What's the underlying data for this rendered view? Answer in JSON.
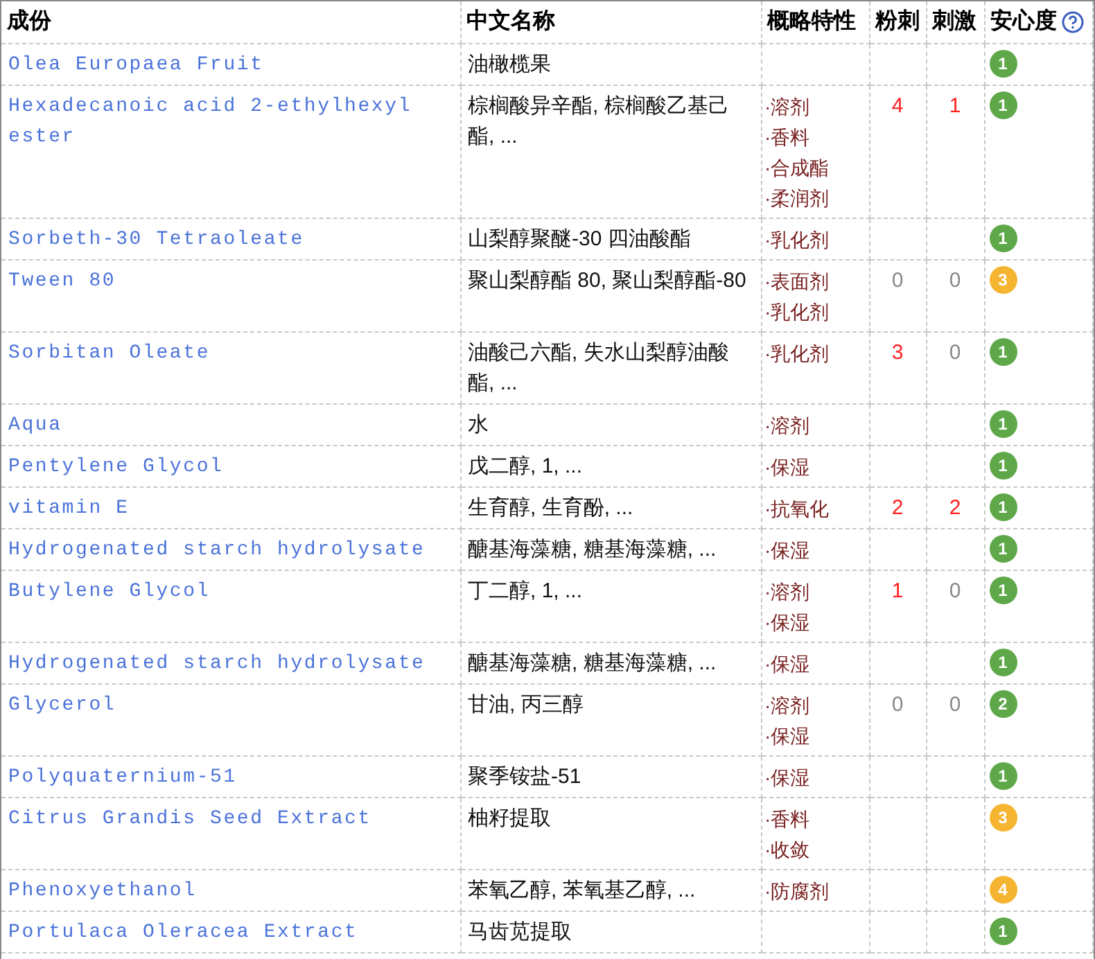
{
  "table": {
    "columns": [
      "成份",
      "中文名称",
      "概略特性",
      "粉刺",
      "刺激",
      "安心度"
    ],
    "rows": [
      {
        "name": "Olea Europaea Fruit",
        "chinese": "油橄榄果",
        "traits": [],
        "safety": {
          "value": "1",
          "color": "#5fa84a"
        }
      },
      {
        "name": "Hexadecanoic acid 2-ethylhexyl ester",
        "chinese": "棕榈酸异辛酯, 棕榈酸乙基己酯, ...",
        "traits": [
          "·溶剂",
          "·香料",
          "·合成酯",
          "·柔润剂"
        ],
        "acne": {
          "value": "4",
          "color": "#ff2020"
        },
        "irritation": {
          "value": "1",
          "color": "#ff2020"
        },
        "safety": {
          "value": "1",
          "color": "#5fa84a"
        }
      },
      {
        "name": "Sorbeth-30 Tetraoleate",
        "chinese": "山梨醇聚醚-30 四油酸酯",
        "traits": [
          "·乳化剂"
        ],
        "safety": {
          "value": "1",
          "color": "#5fa84a"
        }
      },
      {
        "name": "Tween 80",
        "chinese": "聚山梨醇酯 80, 聚山梨醇酯-80",
        "traits": [
          "·表面剂",
          "·乳化剂"
        ],
        "acne": {
          "value": "0",
          "color": "#888888"
        },
        "irritation": {
          "value": "0",
          "color": "#888888"
        },
        "safety": {
          "value": "3",
          "color": "#f5b531"
        }
      },
      {
        "name": "Sorbitan Oleate",
        "chinese": "油酸己六酯, 失水山梨醇油酸酯, ...",
        "traits": [
          "·乳化剂"
        ],
        "acne": {
          "value": "3",
          "color": "#ff2020"
        },
        "irritation": {
          "value": "0",
          "color": "#888888"
        },
        "safety": {
          "value": "1",
          "color": "#5fa84a"
        }
      },
      {
        "name": "Aqua",
        "chinese": "水",
        "traits": [
          "·溶剂"
        ],
        "safety": {
          "value": "1",
          "color": "#5fa84a"
        }
      },
      {
        "name": "Pentylene Glycol",
        "chinese": "戊二醇, 1, ...",
        "traits": [
          "·保湿"
        ],
        "safety": {
          "value": "1",
          "color": "#5fa84a"
        }
      },
      {
        "name": "vitamin E",
        "chinese": "生育醇, 生育酚, ...",
        "traits": [
          "·抗氧化"
        ],
        "acne": {
          "value": "2",
          "color": "#ff2020"
        },
        "irritation": {
          "value": "2",
          "color": "#ff2020"
        },
        "safety": {
          "value": "1",
          "color": "#5fa84a"
        }
      },
      {
        "name": "Hydrogenated starch hydrolysate",
        "chinese": "醣基海藻糖, 糖基海藻糖, ...",
        "traits": [
          "·保湿"
        ],
        "safety": {
          "value": "1",
          "color": "#5fa84a"
        }
      },
      {
        "name": "Butylene Glycol",
        "chinese": "丁二醇, 1, ...",
        "traits": [
          "·溶剂",
          "·保湿"
        ],
        "acne": {
          "value": "1",
          "color": "#ff2020"
        },
        "irritation": {
          "value": "0",
          "color": "#888888"
        },
        "safety": {
          "value": "1",
          "color": "#5fa84a"
        }
      },
      {
        "name": "Hydrogenated starch hydrolysate",
        "chinese": "醣基海藻糖, 糖基海藻糖, ...",
        "traits": [
          "·保湿"
        ],
        "safety": {
          "value": "1",
          "color": "#5fa84a"
        }
      },
      {
        "name": "Glycerol",
        "chinese": "甘油, 丙三醇",
        "traits": [
          "·溶剂",
          "·保湿"
        ],
        "acne": {
          "value": "0",
          "color": "#888888"
        },
        "irritation": {
          "value": "0",
          "color": "#888888"
        },
        "safety": {
          "value": "2",
          "color": "#5fa84a"
        }
      },
      {
        "name": "Polyquaternium-51",
        "chinese": "聚季铵盐-51",
        "traits": [
          "·保湿"
        ],
        "safety": {
          "value": "1",
          "color": "#5fa84a"
        }
      },
      {
        "name": "Citrus Grandis Seed Extract",
        "chinese": "柚籽提取",
        "traits": [
          "·香料",
          "·收敛"
        ],
        "safety": {
          "value": "3",
          "color": "#f5b531"
        }
      },
      {
        "name": "Phenoxyethanol",
        "chinese": "苯氧乙醇, 苯氧基乙醇, ...",
        "traits": [
          "·防腐剂"
        ],
        "safety": {
          "value": "4",
          "color": "#f5b531"
        }
      },
      {
        "name": "Portulaca Oleracea Extract",
        "chinese": "马齿苋提取",
        "traits": [],
        "safety": {
          "value": "1",
          "color": "#5fa84a"
        }
      }
    ]
  }
}
